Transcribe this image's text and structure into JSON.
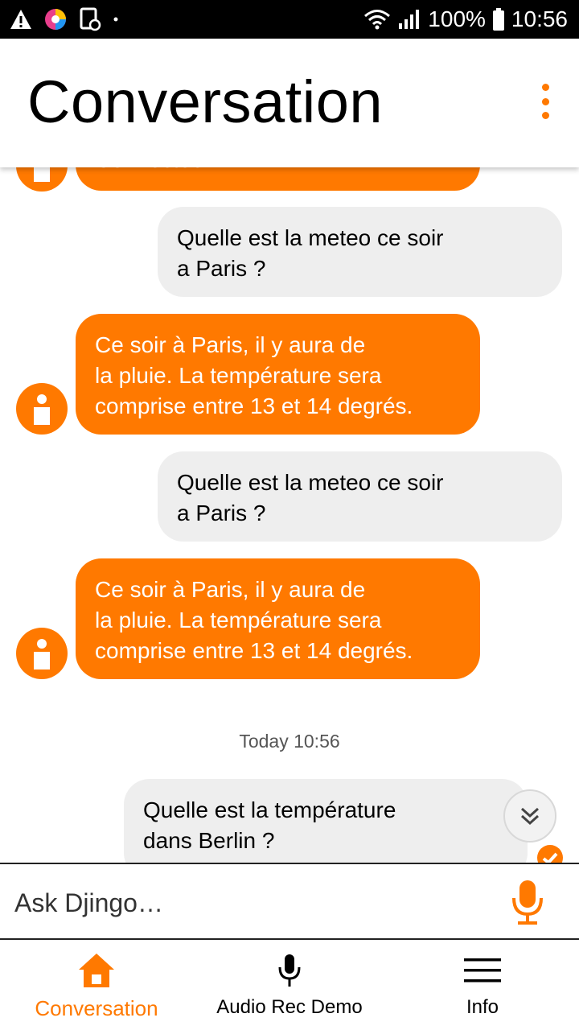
{
  "status_bar": {
    "battery": "100%",
    "time": "10:56"
  },
  "app_bar": {
    "title": "Conversation"
  },
  "messages": [
    {
      "sender": "bot",
      "text": "Connectée."
    },
    {
      "sender": "user",
      "text": "Quelle est la meteo ce soir\na Paris ?"
    },
    {
      "sender": "bot",
      "text": "Ce soir à Paris, il y aura de\nla pluie. La température sera\ncomprise entre 13 et 14 degrés."
    },
    {
      "sender": "user",
      "text": "Quelle est la meteo ce soir\na Paris ?"
    },
    {
      "sender": "bot",
      "text": "Ce soir à Paris, il y aura de\nla pluie. La température sera\ncomprise entre 13 et 14 degrés."
    },
    {
      "sender": "user",
      "text": "Quelle est la température\ndans Berlin ?"
    }
  ],
  "timestamp": "Today 10:56",
  "input": {
    "placeholder": "Ask Djingo…"
  },
  "nav": {
    "items": [
      {
        "label": "Conversation",
        "icon": "home-icon",
        "active": true
      },
      {
        "label": "Audio Rec Demo",
        "icon": "microphone-icon",
        "active": false
      },
      {
        "label": "Info",
        "icon": "menu-icon",
        "active": false
      }
    ]
  },
  "colors": {
    "accent": "#ff7900",
    "user_bubble": "#eeeeee"
  }
}
